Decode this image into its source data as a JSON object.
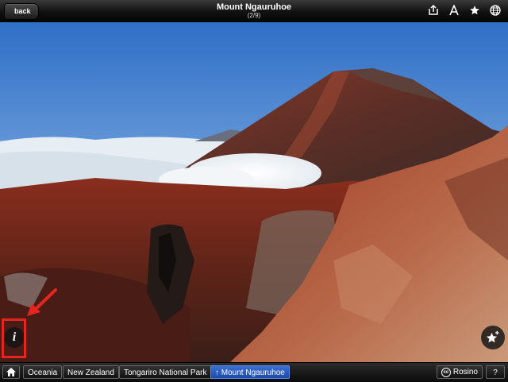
{
  "header": {
    "back_label": "back",
    "title": "Mount Ngauruhoe",
    "position": "(2/9)",
    "icons": [
      "share-icon",
      "font-icon",
      "star-icon",
      "globe-icon"
    ]
  },
  "breadcrumbs": {
    "home_icon": "home-icon",
    "items": [
      "Oceania",
      "New Zealand",
      "Tongariro National Park",
      "Mount Ngauruhoe"
    ],
    "active_prefix": "↑"
  },
  "credit": {
    "icon": "creative-commons-icon",
    "label": "Rosino"
  },
  "help": {
    "label": "?"
  },
  "overlays": {
    "info_icon": "info-icon",
    "info_glyph": "i",
    "favorite_icon": "star-plus-icon",
    "annotation_color": "#e5251f"
  },
  "colors": {
    "active_crumb": "#2c5fc4",
    "sky_top": "#2f6fc6",
    "sky_bottom": "#c7dcf0"
  }
}
